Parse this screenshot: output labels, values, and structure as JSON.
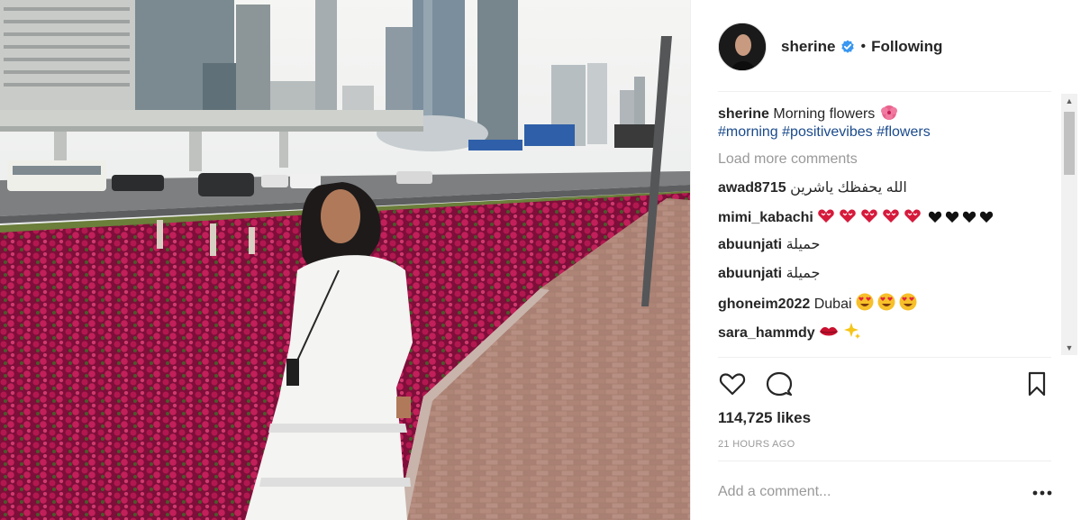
{
  "post": {
    "username": "sherine",
    "follow_separator": "•",
    "follow_status": "Following",
    "caption_text": "Morning flowers",
    "caption_emoji": "hibiscus-emoji",
    "hashtags": [
      "#morning",
      "#positivevibes",
      "#flowers"
    ],
    "load_more": "Load more comments",
    "likes": "114,725 likes",
    "time": "21 HOURS AGO",
    "add_comment_placeholder": "Add a comment...",
    "more_options": "more-options-icon"
  },
  "comments": [
    {
      "user": "awad8715",
      "text": "الله يحفظك ياشرين",
      "emoji": []
    },
    {
      "user": "mimi_kabachi",
      "text": "",
      "emoji": [
        "heart-eyes-red",
        "heart-eyes-red",
        "heart-eyes-red",
        "heart-eyes-red",
        "heart-eyes-red",
        "black-heart",
        "black-heart",
        "black-heart",
        "black-heart"
      ]
    },
    {
      "user": "abuunjati",
      "text": "حميلة",
      "emoji": []
    },
    {
      "user": "abuunjati",
      "text": "جميلة",
      "emoji": []
    },
    {
      "user": "ghoneim2022",
      "text": "Dubai",
      "emoji": [
        "heart-eyes-face",
        "heart-eyes-face",
        "heart-eyes-face"
      ]
    },
    {
      "user": "sara_hammdy",
      "text": "",
      "emoji": [
        "lips",
        "sparkles"
      ]
    }
  ],
  "colors": {
    "username": "#262626",
    "hashtag": "#1a4a8c",
    "muted": "#999999",
    "verified": "#3897f0",
    "flower": "#a3124a"
  },
  "icons": [
    "heart-icon",
    "comment-icon",
    "bookmark-icon",
    "verified-badge-icon",
    "more-options-icon"
  ]
}
